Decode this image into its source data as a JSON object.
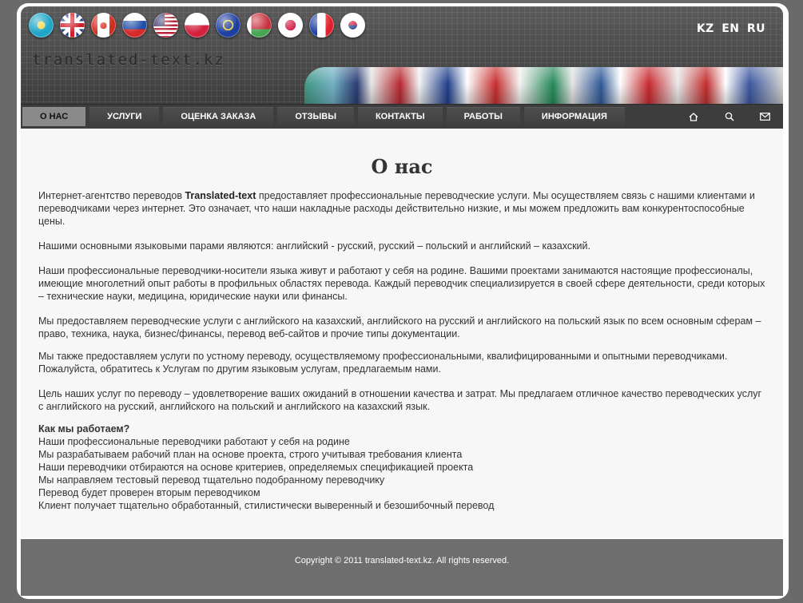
{
  "header": {
    "logo_text": "translated-text.kz",
    "flags": [
      {
        "name": "kazakhstan-flag-icon",
        "colors": [
          "#1fa6c9",
          "#f2d94a"
        ]
      },
      {
        "name": "uk-flag-icon",
        "colors": [
          "#1f3a84",
          "#ffffff",
          "#cf1f2e"
        ]
      },
      {
        "name": "canada-flag-icon",
        "colors": [
          "#d52b1e",
          "#ffffff"
        ]
      },
      {
        "name": "russia-flag-icon",
        "colors": [
          "#ffffff",
          "#1f4fa8",
          "#d42a2a"
        ]
      },
      {
        "name": "usa-flag-icon",
        "colors": [
          "#b22234",
          "#ffffff",
          "#3c3b6e"
        ]
      },
      {
        "name": "poland-flag-icon",
        "colors": [
          "#ffffff",
          "#d4213d"
        ]
      },
      {
        "name": "eu-flag-icon",
        "colors": [
          "#1f3fa0",
          "#f3d42a"
        ]
      },
      {
        "name": "belarus-flag-icon",
        "colors": [
          "#c8313e",
          "#4aa657"
        ]
      },
      {
        "name": "japan-flag-icon",
        "colors": [
          "#ffffff",
          "#d0103a"
        ]
      },
      {
        "name": "france-flag-icon",
        "colors": [
          "#1f3fa0",
          "#ffffff",
          "#e1222e"
        ]
      },
      {
        "name": "korea-flag-icon",
        "colors": [
          "#ffffff",
          "#c8102e",
          "#1f3f8f"
        ]
      }
    ],
    "languages": [
      "KZ",
      "EN",
      "RU"
    ]
  },
  "nav": {
    "items": [
      {
        "label": "О НАС",
        "active": true
      },
      {
        "label": "УСЛУГИ",
        "active": false
      },
      {
        "label": "ОЦЕНКА ЗАКАЗА",
        "active": false
      },
      {
        "label": "ОТЗЫВЫ",
        "active": false
      },
      {
        "label": "КОНТАКТЫ",
        "active": false
      },
      {
        "label": "РАБОТЫ",
        "active": false
      },
      {
        "label": "ИНФОРМАЦИЯ",
        "active": false
      }
    ],
    "icons": [
      "home-icon",
      "search-icon",
      "mail-icon"
    ]
  },
  "main": {
    "title": "О нас",
    "intro_before": "Интернет-агентство переводов ",
    "intro_bold": "Translated-text",
    "intro_after": " предоставляет профессиональные переводческие услуги. Мы осуществляем связь с нашими клиентами и переводчиками через интернет. Это означает, что наши накладные расходы действительно низкие, и мы можем предложить вам конкурентоспособные цены.",
    "paragraphs": [
      "Нашими основными языковыми парами являются: английский - русский, русский – польский и английский – казахский.",
      "Наши профессиональные переводчики-носители языка живут и работают у себя на родине. Вашими проектами занимаются настоящие профессионалы, имеющие многолетний опыт работы в профильных областях перевода. Каждый переводчик специализируется в своей сфере деятельности, среди которых – технические науки, медицина, юридические науки или финансы.",
      "Мы предоставляем переводческие услуги с английского на казахский, английского на русский и английского на польский язык по всем основным сферам – право, техника, наука, бизнес/финансы, перевод веб-сайтов и прочие типы документации.",
      "Мы также предоставляем услуги по устному переводу, осуществляемому профессиональными, квалифицированными и опытными переводчиками. Пожалуйста, обратитесь к Услугам по другим языковым услугам, предлагаемым нами.",
      "Цель наших услуг по переводу – удовлетворение ваших ожиданий в отношении качества и затрат. Мы предлагаем отличное качество переводческих услуг с английского на русский, английского на польский и английского на казахский язык."
    ],
    "how_title": "Как мы работаем?",
    "how_items": [
      "Наши профессиональные переводчики работают у себя на родине",
      "Мы разрабатываем рабочий план на основе проекта, строго учитывая требования клиента",
      "Наши переводчики отбираются на основе критериев, определяемых спецификацией проекта",
      "Мы направляем тестовый перевод тщательно подобранному переводчику",
      "Перевод будет проверен вторым переводчиком",
      "Клиент получает тщательно обработанный, стилистически выверенный и безошибочный перевод"
    ]
  },
  "footer": {
    "copyright": "Copyright © 2011 translated-text.kz. All rights reserved."
  }
}
